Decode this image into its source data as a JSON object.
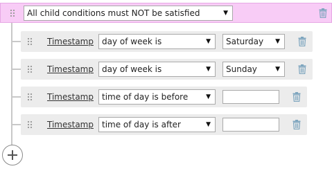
{
  "group": {
    "operator": "All child conditions must NOT be satisfied"
  },
  "conditions": [
    {
      "field": "Timestamp",
      "operator": "day of week is",
      "value": "Saturday"
    },
    {
      "field": "Timestamp",
      "operator": "day of week is",
      "value": "Sunday"
    },
    {
      "field": "Timestamp",
      "operator": "time of day is before",
      "value": ""
    },
    {
      "field": "Timestamp",
      "operator": "time of day is after",
      "value": ""
    }
  ],
  "icons": {
    "grip": "drag-handle-icon",
    "trash": "trash-icon",
    "add": "plus-icon",
    "dropdown": "chevron-down-icon"
  },
  "colors": {
    "group_background": "#f8ccf6",
    "row_background": "#ececec",
    "trash": "#7fa6bf"
  }
}
